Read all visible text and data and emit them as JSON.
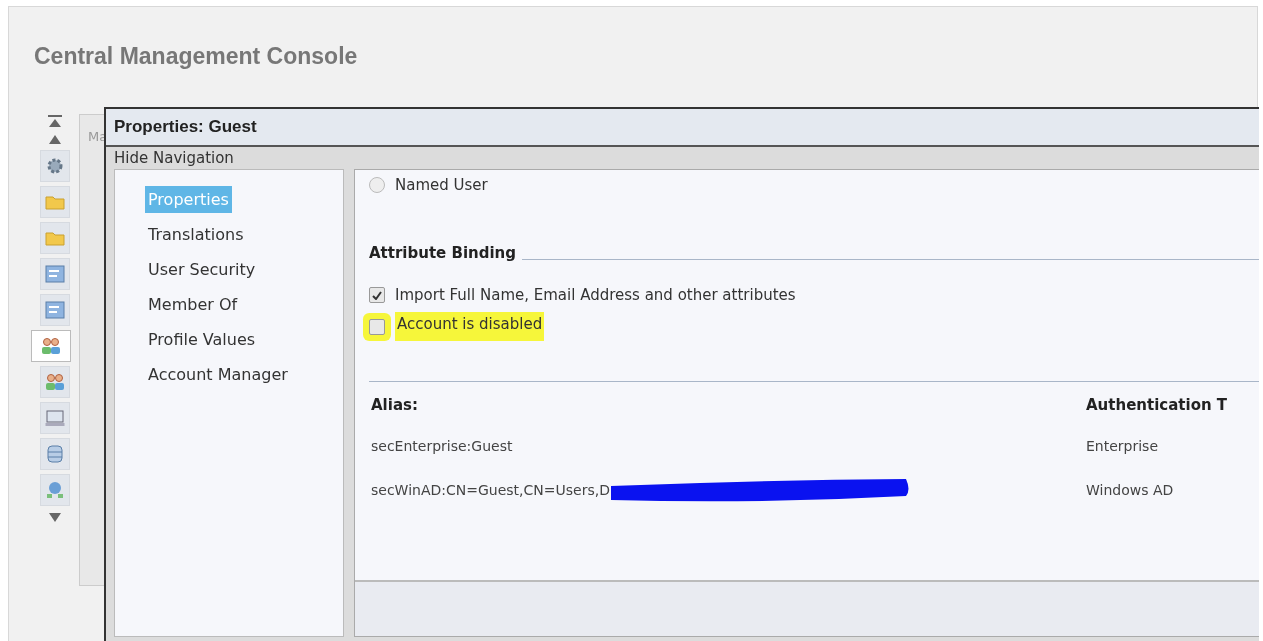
{
  "app_title": "Central Management Console",
  "background_tab": "Ma",
  "side_icons": [
    {
      "kind": "gear",
      "selected": false
    },
    {
      "kind": "folder",
      "selected": false
    },
    {
      "kind": "folder",
      "selected": false
    },
    {
      "kind": "report",
      "selected": false
    },
    {
      "kind": "report",
      "selected": false
    },
    {
      "kind": "users",
      "selected": true
    },
    {
      "kind": "users",
      "selected": false
    },
    {
      "kind": "monitor",
      "selected": false
    },
    {
      "kind": "database",
      "selected": false
    },
    {
      "kind": "network",
      "selected": false
    }
  ],
  "dialog": {
    "title": "Properties: Guest",
    "hide_navigation": "Hide Navigation",
    "nav_items": [
      {
        "label": "Properties",
        "selected": true
      },
      {
        "label": "Translations",
        "selected": false
      },
      {
        "label": "User Security",
        "selected": false
      },
      {
        "label": "Member Of",
        "selected": false
      },
      {
        "label": "Profile Values",
        "selected": false
      },
      {
        "label": "Account Manager",
        "selected": false
      }
    ],
    "radio": {
      "label": "Named User",
      "selected": false
    },
    "section_heading": "Attribute Binding",
    "options": [
      {
        "label": "Import Full Name, Email Address and other attributes",
        "checked": true,
        "highlighted": false
      },
      {
        "label": "Account is disabled",
        "checked": false,
        "highlighted": true
      }
    ],
    "alias_table": {
      "columns": [
        "Alias:",
        "Authentication T"
      ],
      "rows": [
        {
          "alias": "secEnterprise:Guest",
          "auth": "Enterprise"
        },
        {
          "alias": "secWinAD:CN=Guest,CN=Users,D",
          "redacted": true,
          "auth": "Windows AD"
        }
      ]
    }
  }
}
